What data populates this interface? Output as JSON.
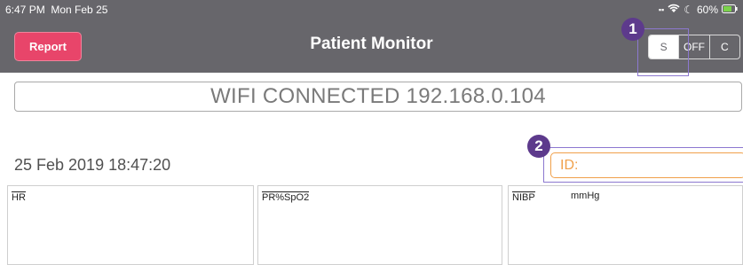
{
  "status_bar": {
    "time": "6:47 PM",
    "date": "Mon Feb 25",
    "battery": "60%"
  },
  "nav": {
    "report_label": "Report",
    "title": "Patient Monitor",
    "segments": [
      "S",
      "OFF",
      "C"
    ]
  },
  "callouts": [
    "1",
    "2"
  ],
  "wifi_status": "WIFI CONNECTED 192.168.0.104",
  "datetime": "25 Feb 2019 18:47:20",
  "id_placeholder": "ID:",
  "panels": [
    {
      "label": "HR",
      "unit": ""
    },
    {
      "label": "PR%SpO2",
      "unit": ""
    },
    {
      "label": "NIBP",
      "unit": "mmHg"
    }
  ],
  "colors": {
    "bar": "#67666b",
    "report": "#e8456a",
    "id_accent": "#f0a04a",
    "callout": "#5d3a8c"
  }
}
